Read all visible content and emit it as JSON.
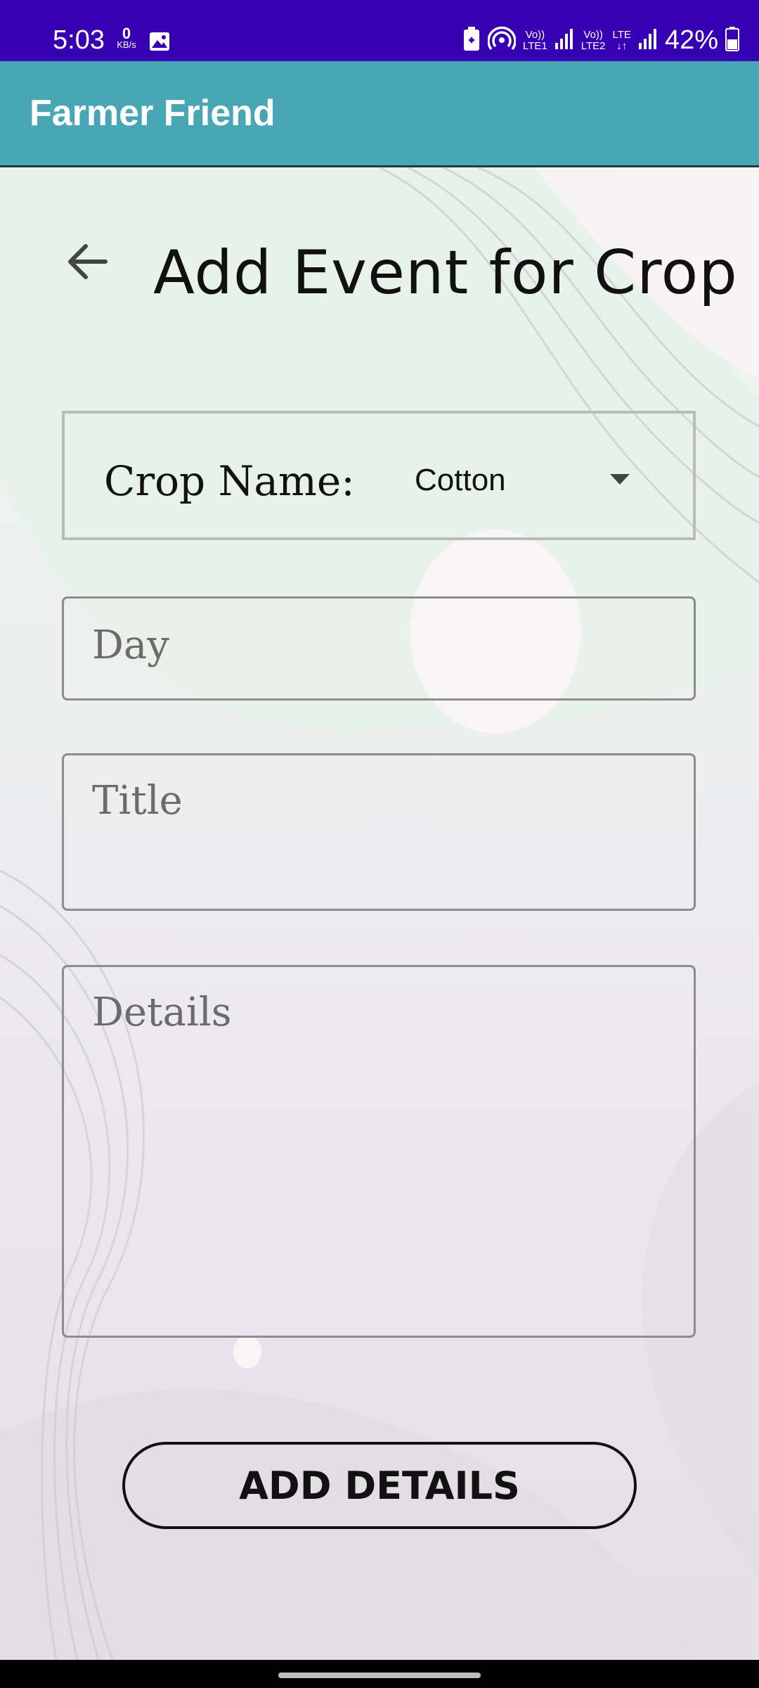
{
  "status_bar": {
    "time": "5:03",
    "data_speed_value": "0",
    "data_speed_unit": "KB/s",
    "sim1_label_top": "Vo))",
    "sim1_label_bottom": "LTE1",
    "sim2_label_top": "Vo))",
    "sim2_label_bottom": "LTE2",
    "lte_label": "LTE",
    "battery_percent": "42%",
    "icons": [
      "gallery-icon",
      "battery-saver-icon",
      "hotspot-icon",
      "signal-icon",
      "battery-icon"
    ]
  },
  "app_bar": {
    "title": "Farmer Friend",
    "color": "#48a6b5"
  },
  "page": {
    "back_icon": "arrow-left-icon",
    "title": "Add Event for Crop"
  },
  "form": {
    "crop_label": "Crop Name:",
    "crop_selected": "Cotton",
    "day_placeholder": "Day",
    "title_placeholder": "Title",
    "details_placeholder": "Details",
    "submit_label": "ADD DETAILS"
  },
  "colors": {
    "status_bar": "#3700b3",
    "app_bar": "#48a6b5"
  }
}
